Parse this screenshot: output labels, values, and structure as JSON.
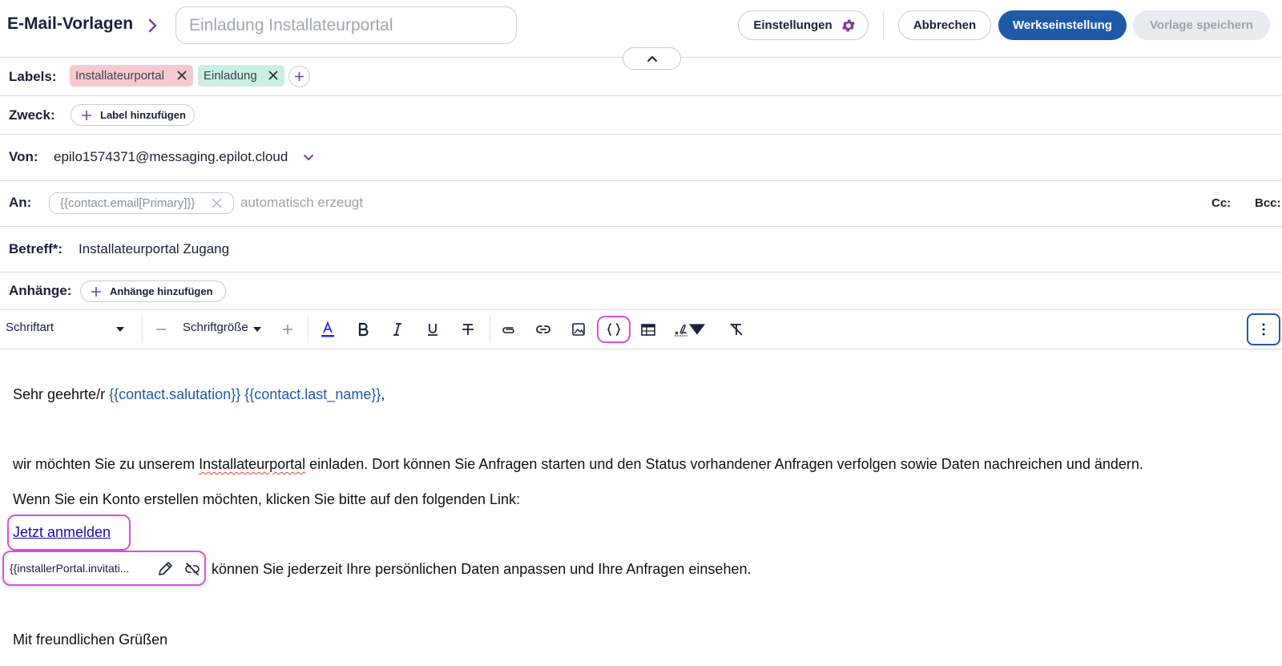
{
  "header": {
    "title": "E-Mail-Vorlagen",
    "template_name_placeholder": "Einladung Installateurportal",
    "settings_label": "Einstellungen",
    "cancel_label": "Abbrechen",
    "default_label": "Werkseinstellung",
    "save_label": "Vorlage speichern"
  },
  "labels_row": {
    "label": "Labels:",
    "chips": [
      "Installateurportal",
      "Einladung"
    ]
  },
  "purpose_row": {
    "label": "Zweck:",
    "add_label": "Label hinzufügen"
  },
  "from_row": {
    "label": "Von:",
    "value": "epilo1574371@messaging.epilot.cloud"
  },
  "to_row": {
    "label": "An:",
    "chip": "{{contact.email[Primary]}}",
    "hint": "automatisch erzeugt",
    "cc": "Cc:",
    "bcc": "Bcc:"
  },
  "subject_row": {
    "label": "Betreff*:",
    "value": "Installateurportal Zugang"
  },
  "attachments_row": {
    "label": "Anhänge:",
    "add_label": "Anhänge hinzufügen"
  },
  "toolbar": {
    "font_label": "Schriftart",
    "size_label": "Schriftgröße"
  },
  "body": {
    "greeting_prefix": "Sehr geehrte/r ",
    "salutation_var": "{{contact.salutation}}",
    "lastname_var": "{{contact.last_name}}",
    "greeting_suffix": ",",
    "para1_a": "wir möchten Sie zu unserem ",
    "para1_word": "Installateurportal",
    "para1_b": " einladen. Dort können Sie Anfragen starten und den Status vorhandener Anfragen verfolgen sowie Daten nachreichen und ändern.",
    "para2": "Wenn Sie ein Konto erstellen möchten, klicken Sie bitte auf den folgenden Link:",
    "link_text": "Jetzt anmelden",
    "para3": "können Sie jederzeit Ihre persönlichen Daten anpassen und Ihre Anfragen einsehen.",
    "closing": "Mit freundlichen Grüßen"
  },
  "link_popup": {
    "url": "{{installerPortal.invitati..."
  },
  "colors": {
    "primary": "#1f5aa8",
    "highlight": "#d94fe0",
    "chip_pink": "#f6c9cd",
    "chip_green": "#c8efe0",
    "accent_purple": "#7a3fa0"
  }
}
